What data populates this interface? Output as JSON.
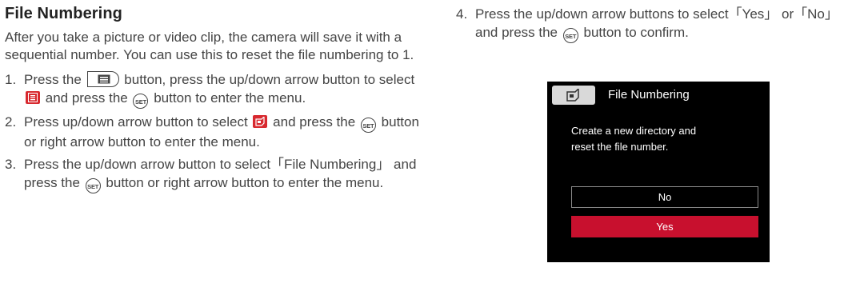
{
  "section": {
    "title": "File Numbering",
    "intro": "After you take a picture or video clip, the camera will save it with a sequential number. You can use this to reset the file numbering to 1."
  },
  "steps": [
    {
      "num": "1.",
      "t1": "Press the",
      "t2": "button, press the up/down arrow button to select",
      "t3": "and press the",
      "t4": "button to enter the menu."
    },
    {
      "num": "2.",
      "t1": "Press up/down arrow button to select",
      "t2": "and press the",
      "t3": "button or right arrow button to enter the menu."
    },
    {
      "num": "3.",
      "t1": "Press the up/down arrow button to select「File Numbering」 and press the",
      "t2": "button or right arrow button to enter the menu."
    },
    {
      "num": "4.",
      "t1": "Press the up/down arrow buttons to select「Yes」 or「No」 and press the",
      "t2": "button to confirm."
    }
  ],
  "icons": {
    "set_label": "SET",
    "menu_button": "menu-button-icon",
    "menu_tile": "red-menu-tile-icon",
    "file_tile": "red-file-setting-icon"
  },
  "colors": {
    "accent_red": "#d8292f",
    "screen_bg": "#000000",
    "selected_option": "#c8102e"
  },
  "screen": {
    "title": "File Numbering",
    "message_line1": "Create a new directory and",
    "message_line2": "reset the file number.",
    "options": [
      {
        "label": "No",
        "selected": false
      },
      {
        "label": "Yes",
        "selected": true
      }
    ]
  }
}
